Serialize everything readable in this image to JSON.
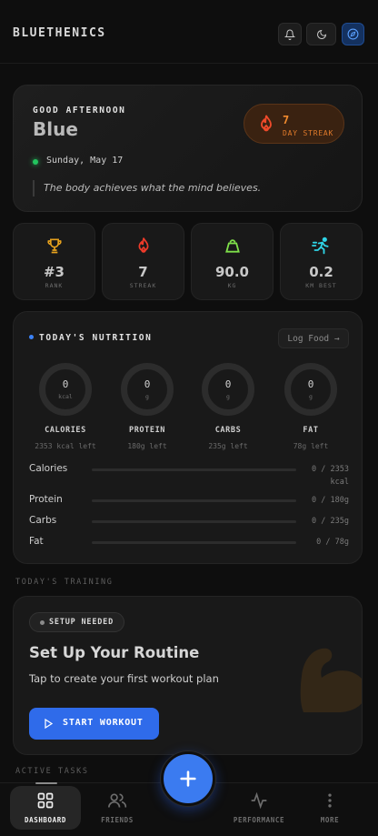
{
  "header": {
    "brand": "BLUETHENICS"
  },
  "greeting": {
    "salutation": "GOOD AFTERNOON",
    "name": "Blue",
    "date": "Sunday, May 17",
    "quote": "The body achieves what the mind believes.",
    "streak_value": "7",
    "streak_label": "DAY STREAK"
  },
  "stats": [
    {
      "icon": "trophy-icon",
      "value": "#3",
      "unit": "RANK"
    },
    {
      "icon": "flame-icon",
      "value": "7",
      "unit": "STREAK"
    },
    {
      "icon": "kettlebell-icon",
      "value": "90.0",
      "unit": "KG"
    },
    {
      "icon": "runner-icon",
      "value": "0.2",
      "unit": "KM BEST"
    }
  ],
  "nutrition": {
    "title": "TODAY'S NUTRITION",
    "log_button": "Log Food →",
    "macros": [
      {
        "value": "0",
        "unit": "kcal",
        "label": "CALORIES",
        "left": "2353 kcal left"
      },
      {
        "value": "0",
        "unit": "g",
        "label": "PROTEIN",
        "left": "180g left"
      },
      {
        "value": "0",
        "unit": "g",
        "label": "CARBS",
        "left": "235g left"
      },
      {
        "value": "0",
        "unit": "g",
        "label": "FAT",
        "left": "78g left"
      }
    ],
    "bars": [
      {
        "label": "Calories",
        "value": "0 / 2353 kcal",
        "progress": 0
      },
      {
        "label": "Protein",
        "value": "0 / 180g",
        "progress": 0
      },
      {
        "label": "Carbs",
        "value": "0 / 235g",
        "progress": 0
      },
      {
        "label": "Fat",
        "value": "0 / 78g",
        "progress": 0
      }
    ]
  },
  "training": {
    "section_label": "TODAY'S TRAINING",
    "badge": "SETUP NEEDED",
    "title": "Set Up Your Routine",
    "subtitle": "Tap to create your first workout plan",
    "button": "START WORKOUT"
  },
  "tasks": {
    "section_label": "ACTIVE TASKS"
  },
  "nav": [
    {
      "icon": "grid-icon",
      "label": "DASHBOARD"
    },
    {
      "icon": "users-icon",
      "label": "FRIENDS"
    },
    {
      "icon": "activity-icon",
      "label": "PERFORMANCE"
    },
    {
      "icon": "more-vertical-icon",
      "label": "MORE"
    }
  ],
  "colors": {
    "accent": "#3b7bf0",
    "streak": "#f28b2e",
    "online": "#22c55e"
  }
}
